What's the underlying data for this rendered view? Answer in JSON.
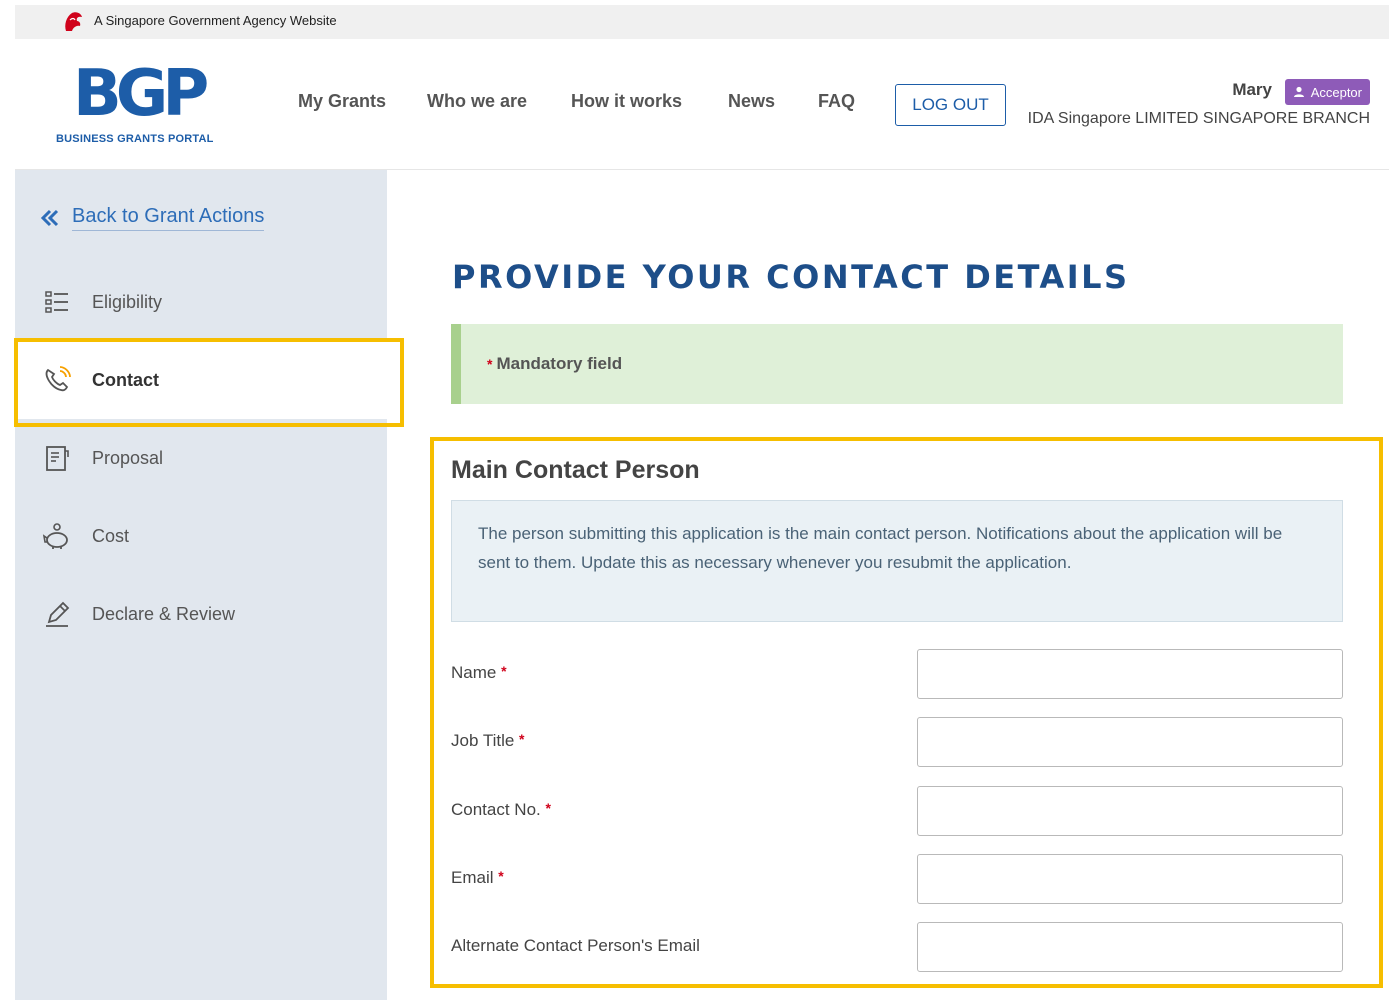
{
  "gov_bar": {
    "text": "A Singapore Government Agency Website",
    "lion_color": "#d0021b"
  },
  "header": {
    "logo_text": "BGP",
    "logo_subtitle": "BUSINESS GRANTS PORTAL",
    "nav": [
      {
        "label": "My Grants"
      },
      {
        "label": "Who we are"
      },
      {
        "label": "How it works"
      },
      {
        "label": "News"
      },
      {
        "label": "FAQ"
      }
    ],
    "logout_label": "LOG OUT",
    "user_name": "Mary",
    "role_label": "Acceptor",
    "org_name": "IDA Singapore LIMITED SINGAPORE BRANCH"
  },
  "sidebar": {
    "back_label": "Back to Grant Actions",
    "items": [
      {
        "label": "Eligibility",
        "icon": "list-icon",
        "active": false
      },
      {
        "label": "Contact",
        "icon": "phone-icon",
        "active": true
      },
      {
        "label": "Proposal",
        "icon": "document-icon",
        "active": false
      },
      {
        "label": "Cost",
        "icon": "piggy-bank-icon",
        "active": false
      },
      {
        "label": "Declare & Review",
        "icon": "pen-icon",
        "active": false
      }
    ]
  },
  "main": {
    "title": "PROVIDE YOUR CONTACT DETAILS",
    "mandatory_note": "Mandatory field",
    "section_title": "Main Contact Person",
    "info_text": "The person submitting this application is the main contact person. Notifications about the application will be sent to them. Update this as necessary whenever you resubmit the application.",
    "fields": [
      {
        "label": "Name",
        "required": true,
        "value": ""
      },
      {
        "label": "Job Title",
        "required": true,
        "value": ""
      },
      {
        "label": "Contact No.",
        "required": true,
        "value": ""
      },
      {
        "label": "Email",
        "required": true,
        "value": ""
      },
      {
        "label": "Alternate Contact Person's Email",
        "required": false,
        "value": ""
      }
    ]
  },
  "colors": {
    "brand": "#1d5da8",
    "title": "#1d4e89",
    "highlight": "#f6be00",
    "badge": "#8e5bb8",
    "required": "#d0021b",
    "mandatory_bg": "#dff0d8"
  }
}
